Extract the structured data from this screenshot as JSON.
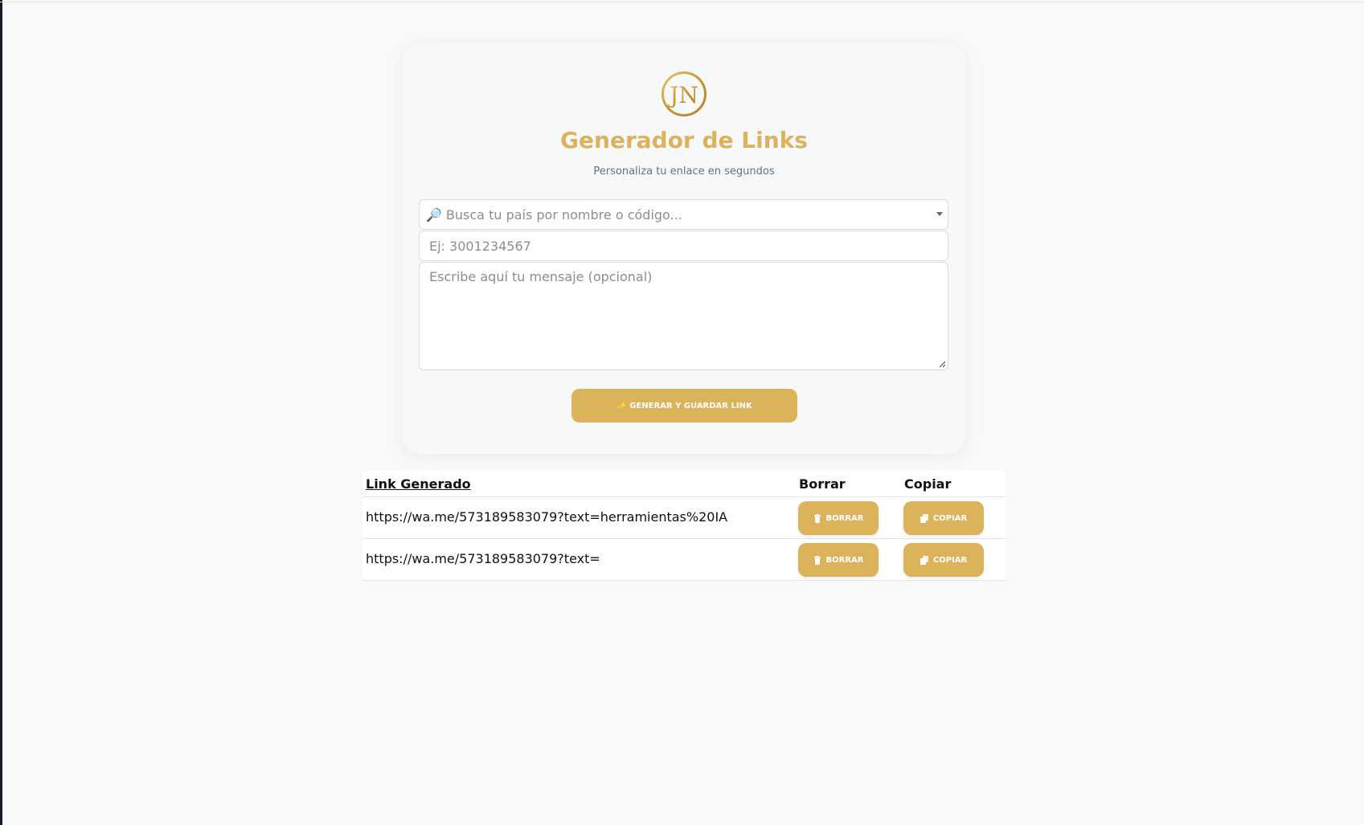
{
  "app": {
    "title": "Generador de Links",
    "subtitle": "Personaliza tu enlace en segundos",
    "logo_text": "JN",
    "accent_color": "#dbb35a"
  },
  "form": {
    "country": {
      "icon": "magnifier-emoji",
      "icon_glyph": "🔎",
      "placeholder": "Busca tu país por nombre o código..."
    },
    "phone": {
      "placeholder": "Ej: 3001234567",
      "value": ""
    },
    "message": {
      "placeholder": "Escribe aquí tu mensaje (opcional)",
      "value": ""
    },
    "generate_label": "✨ GENERAR Y GUARDAR LINK"
  },
  "table": {
    "headers": {
      "link": "Link Generado",
      "delete": "Borrar",
      "copy": "Copiar"
    },
    "rows": [
      {
        "link": "https://wa.me/573189583079?text=herramientas%20IA",
        "delete_label": "BORRAR",
        "copy_label": "COPIAR"
      },
      {
        "link": "https://wa.me/573189583079?text=",
        "delete_label": "BORRAR",
        "copy_label": "COPIAR"
      }
    ]
  }
}
